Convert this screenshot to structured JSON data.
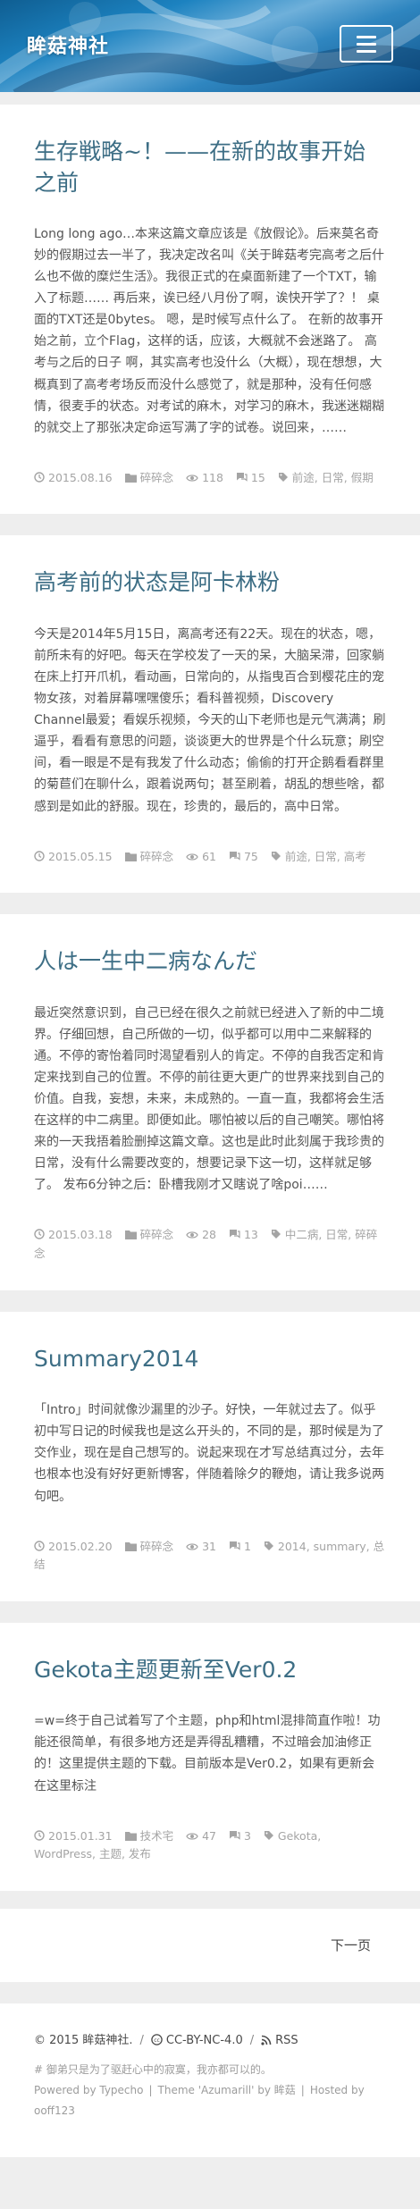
{
  "header": {
    "site_name": "眸菇神社",
    "menu_icon": "hamburger-icon"
  },
  "posts": [
    {
      "title": "生存戦略~！——在新的故事开始之前",
      "excerpt": "Long long ago…本来这篇文章应该是《放假论》。后来莫名奇妙的假期过去一半了，我决定改名叫《关于眸菇考完高考之后什么也不做的糜烂生活》。我很正式的在桌面新建了一个TXT，输入了标题…… 再后来，诶已经八月份了啊，诶快开学了？！ 桌面的TXT还是0bytes。 嗯，是时候写点什么了。 在新的故事开始之前，立个Flag，这样的话，应该，大概就不会迷路了。 高考与之后的日子 啊，其实高考也没什么（大概），现在想想，大概真到了高考考场反而没什么感觉了，就是那种，没有任何感情，很麦手的状态。对考试的麻木，对学习的麻木，我迷迷糊糊的就交上了那张决定命运写满了字的试卷。说回来，……",
      "date": "2015.08.16",
      "category": "碎碎念",
      "views": "118",
      "comments": "15",
      "tags": "前途, 日常, 假期"
    },
    {
      "title": "高考前的状态是阿卡林粉",
      "excerpt": "今天是2014年5月15日，离高考还有22天。现在的状态，嗯，前所未有的好吧。每天在学校发了一天的呆，大脑呆滞，回家躺在床上打开爪机，看动画，日常向的，从指曳百合到樱花庄的宠物女孩，对着屏幕嘿嘿傻乐；看科普视频，Discovery Channel最爱；看娱乐视频，今天的山下老师也是元气满满；刷逼乎，看看有意思的问题，谈谈更大的世界是个什么玩意；刷空间，看一眼是不是有我发了什么动态；偷偷的打开企鹅看看群里的菊苣们在聊什么，跟着说两句；甚至刷着，胡乱的想些啥，都感到是如此的舒服。现在，珍贵的，最后的，高中日常。",
      "date": "2015.05.15",
      "category": "碎碎念",
      "views": "61",
      "comments": "75",
      "tags": "前途, 日常, 高考"
    },
    {
      "title": "人は一生中二病なんだ",
      "excerpt": "最近突然意识到，自己已经在很久之前就已经进入了新的中二境界。仔细回想，自己所做的一切，似乎都可以用中二来解释的通。不停的寄怡着同时渴望看别人的肯定。不停的自我否定和肯定来找到自己的位置。不停的前往更大更广的世界来找到自己的价值。自我，妄想，未来，未成熟的。一直一直，我都将会生活在这样的中二病里。即便如此。哪怕被以后的自己嘲笑。哪怕将来的一天我捂着脸删掉这篇文章。这也是此时此刻属于我珍贵的日常，没有什么需要改变的，想要记录下这一切，这样就足够了。 发布6分钟之后：卧槽我刚才又瞎说了啥poi……",
      "date": "2015.03.18",
      "category": "碎碎念",
      "views": "28",
      "comments": "13",
      "tags": "中二病, 日常, 碎碎念"
    },
    {
      "title": "Summary2014",
      "excerpt": "「Intro」时间就像沙漏里的沙子。好快，一年就过去了。似乎初中写日记的时候我也是这么开头的，不同的是，那时候是为了交作业，现在是自己想写的。说起来现在才写总结真过分，去年也根本也没有好好更新博客，伴随着除夕的鞭炮，请让我多说两句吧。",
      "date": "2015.02.20",
      "category": "碎碎念",
      "views": "31",
      "comments": "1",
      "tags": "2014, summary, 总结"
    },
    {
      "title": "Gekota主题更新至Ver0.2",
      "excerpt": "=w=终于自己试着写了个主题，php和html混排简直作啦！功能还很简单，有很多地方还是弄得乱糟糟，不过暗会加油修正的！这里提供主题的下载。目前版本是Ver0.2，如果有更新会在这里标注",
      "date": "2015.01.31",
      "category": "技术宅",
      "views": "47",
      "comments": "3",
      "tags": "Gekota, WordPress, 主题, 发布"
    }
  ],
  "pager": {
    "next_label": "下一页"
  },
  "footer": {
    "copyright": "© 2015 眸菇神社.",
    "license_label": "CC-BY-NC-4.0",
    "rss_label": "RSS",
    "motto": "# 御弟只是为了驱赶心中的寂寞，我亦都可以的。",
    "powered": "Powered by Typecho",
    "theme": "Theme 'Azumarill' by 眸菇",
    "hosted": "Hosted by ooff123"
  },
  "colors": {
    "title": "#3d6e85",
    "meta": "#a4a4a4",
    "background": "#eeeeee",
    "header_blue": "#1c82c0"
  }
}
